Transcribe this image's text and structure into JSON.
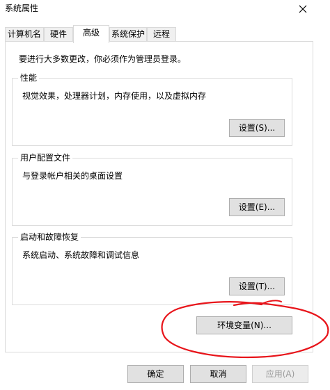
{
  "window": {
    "title": "系统属性",
    "close_label": "×"
  },
  "tabs": [
    {
      "label": "计算机名",
      "active": false
    },
    {
      "label": "硬件",
      "active": false
    },
    {
      "label": "高级",
      "active": true
    },
    {
      "label": "系统保护",
      "active": false
    },
    {
      "label": "远程",
      "active": false
    }
  ],
  "advanced": {
    "admin_note": "要进行大多数更改，你必须作为管理员登录。",
    "performance": {
      "title": "性能",
      "description": "视觉效果，处理器计划，内存使用，以及虚拟内存",
      "button": "设置(S)..."
    },
    "user_profiles": {
      "title": "用户配置文件",
      "description": "与登录帐户相关的桌面设置",
      "button": "设置(E)..."
    },
    "startup_recovery": {
      "title": "启动和故障恢复",
      "description": "系统启动、系统故障和调试信息",
      "button": "设置(T)..."
    },
    "env_button": "环境变量(N)..."
  },
  "footer": {
    "ok": "确定",
    "cancel": "取消",
    "apply": "应用(A)",
    "apply_enabled": false
  },
  "colors": {
    "annotation_red": "#e8141a",
    "tab_border": "#d9d9d9",
    "button_face": "#e1e1e1",
    "disabled_text": "#9a9a9a"
  }
}
